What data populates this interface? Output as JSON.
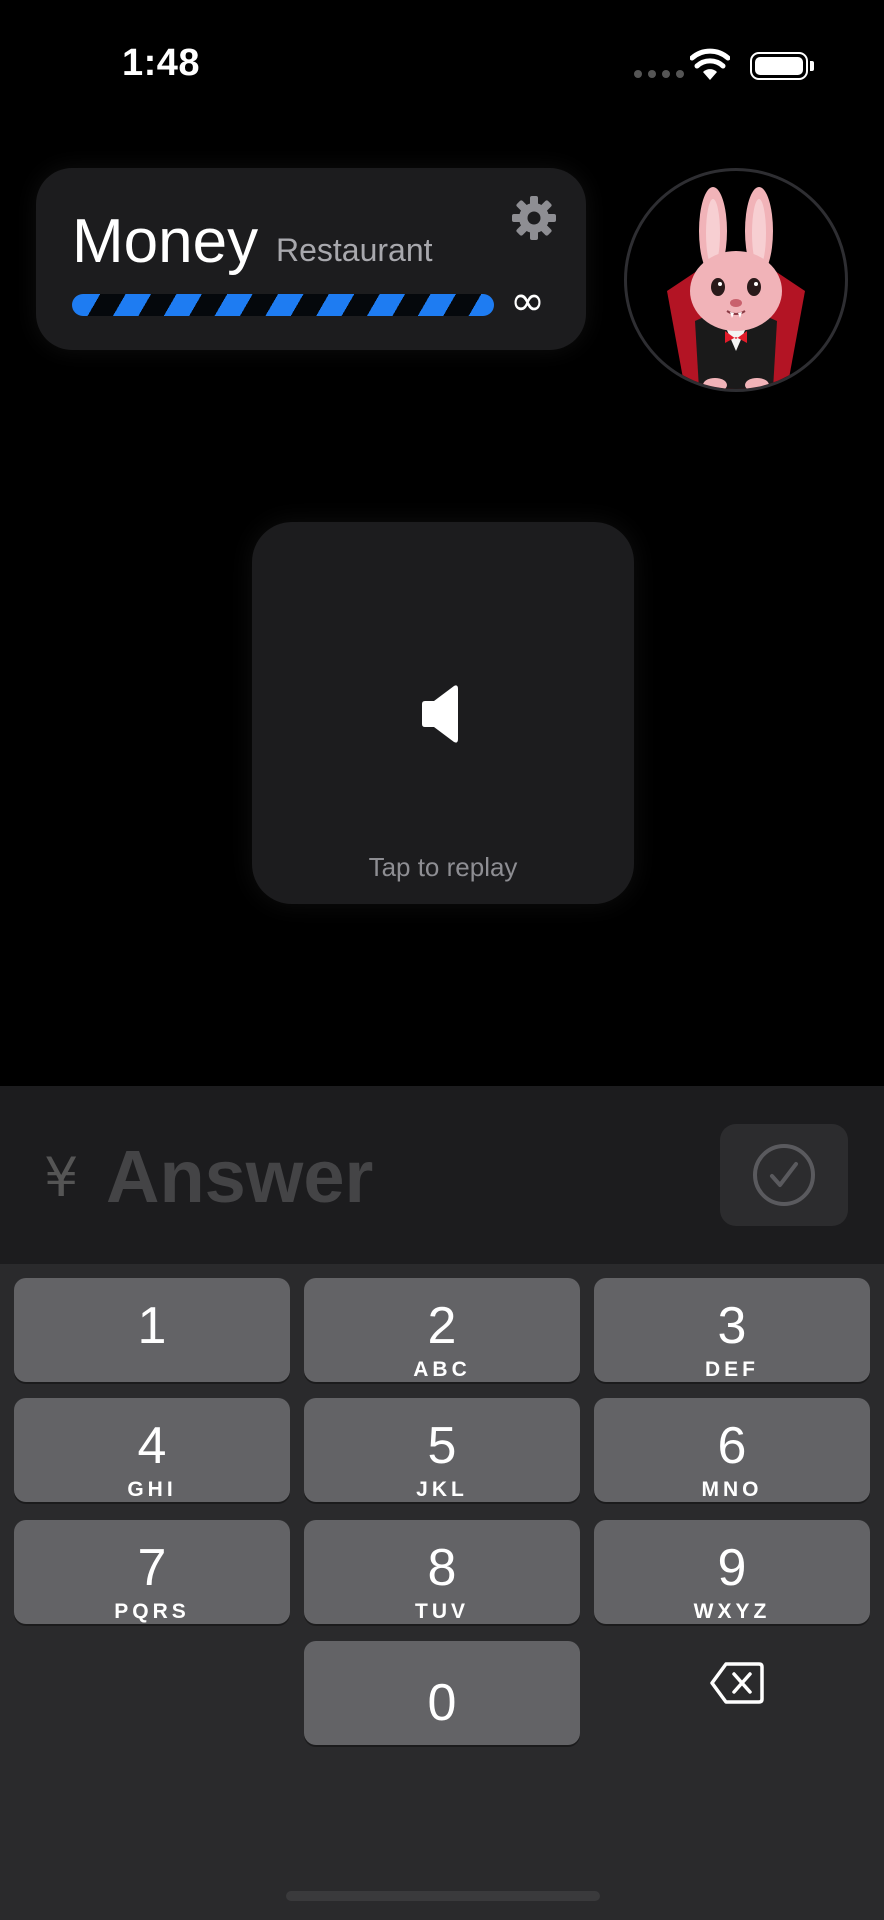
{
  "status_bar": {
    "time": "1:48"
  },
  "header": {
    "title": "Money",
    "subtitle": "Restaurant",
    "progress_symbol": "∞"
  },
  "audio_card": {
    "hint": "Tap to replay"
  },
  "answer": {
    "currency_symbol": "¥",
    "placeholder": "Answer",
    "value": ""
  },
  "keypad": {
    "keys": [
      {
        "number": "1",
        "letters": ""
      },
      {
        "number": "2",
        "letters": "ABC"
      },
      {
        "number": "3",
        "letters": "DEF"
      },
      {
        "number": "4",
        "letters": "GHI"
      },
      {
        "number": "5",
        "letters": "JKL"
      },
      {
        "number": "6",
        "letters": "MNO"
      },
      {
        "number": "7",
        "letters": "PQRS"
      },
      {
        "number": "8",
        "letters": "TUV"
      },
      {
        "number": "9",
        "letters": "WXYZ"
      },
      {
        "number": "0",
        "letters": ""
      }
    ]
  },
  "icons": {
    "settings": "gear-icon",
    "avatar": "bunny-vampire-avatar",
    "replay": "speaker-icon",
    "submit": "checkmark-icon",
    "delete": "backspace-icon"
  },
  "colors": {
    "accent": "#1e7cf2",
    "key": "#636366",
    "panel": "#1c1c1e"
  }
}
